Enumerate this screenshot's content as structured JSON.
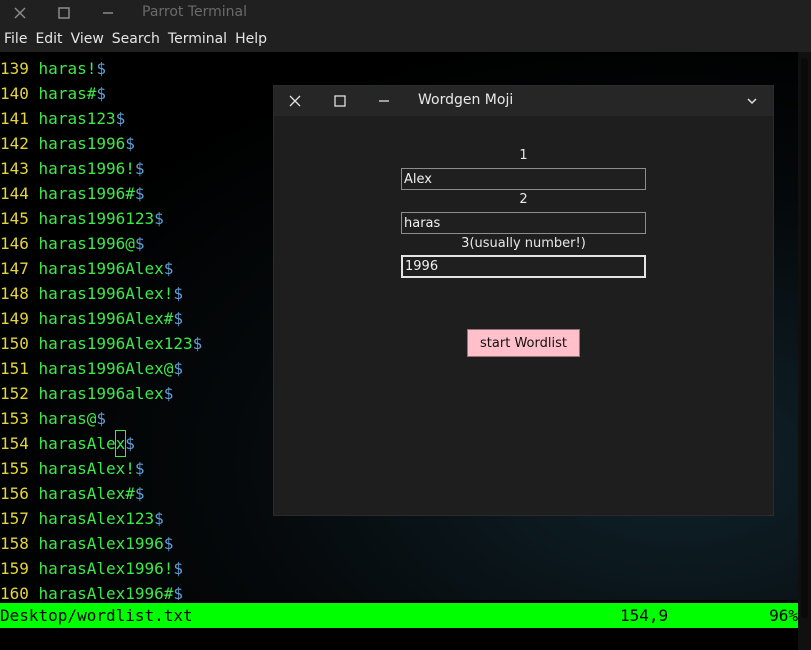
{
  "terminal": {
    "title": "Parrot Terminal",
    "menu": [
      "File",
      "Edit",
      "View",
      "Search",
      "Terminal",
      "Help"
    ],
    "lines": [
      {
        "num": "139",
        "text": "haras!"
      },
      {
        "num": "140",
        "text": "haras#"
      },
      {
        "num": "141",
        "text": "haras123"
      },
      {
        "num": "142",
        "text": "haras1996"
      },
      {
        "num": "143",
        "text": "haras1996!"
      },
      {
        "num": "144",
        "text": "haras1996#"
      },
      {
        "num": "145",
        "text": "haras1996123"
      },
      {
        "num": "146",
        "text": "haras1996@"
      },
      {
        "num": "147",
        "text": "haras1996Alex"
      },
      {
        "num": "148",
        "text": "haras1996Alex!"
      },
      {
        "num": "149",
        "text": "haras1996Alex#"
      },
      {
        "num": "150",
        "text": "haras1996Alex123"
      },
      {
        "num": "151",
        "text": "haras1996Alex@"
      },
      {
        "num": "152",
        "text": "haras1996alex"
      },
      {
        "num": "153",
        "text": "haras@"
      },
      {
        "num": "154",
        "text": "harasAle",
        "cursor": "x"
      },
      {
        "num": "155",
        "text": "harasAlex!"
      },
      {
        "num": "156",
        "text": "harasAlex#"
      },
      {
        "num": "157",
        "text": "harasAlex123"
      },
      {
        "num": "158",
        "text": "harasAlex1996"
      },
      {
        "num": "159",
        "text": "harasAlex1996!"
      },
      {
        "num": "160",
        "text": "harasAlex1996#"
      }
    ],
    "line_end_marker": "$",
    "status": {
      "file": "Desktop/wordlist.txt",
      "position": "154,9",
      "percent": "96%"
    },
    "colors": {
      "line_number": "#e4d53a",
      "text": "#3fe84a",
      "marker": "#5f9ed8",
      "statusbar": "#00ff00"
    }
  },
  "dialog": {
    "title": "Wordgen Moji",
    "field1": {
      "label": "1",
      "value": "Alex"
    },
    "field2": {
      "label": "2",
      "value": "haras"
    },
    "field3": {
      "label": "3(usually number!)",
      "value": "1996"
    },
    "start_button": "start Wordlist",
    "colors": {
      "button_bg": "#ffc0cb"
    }
  }
}
